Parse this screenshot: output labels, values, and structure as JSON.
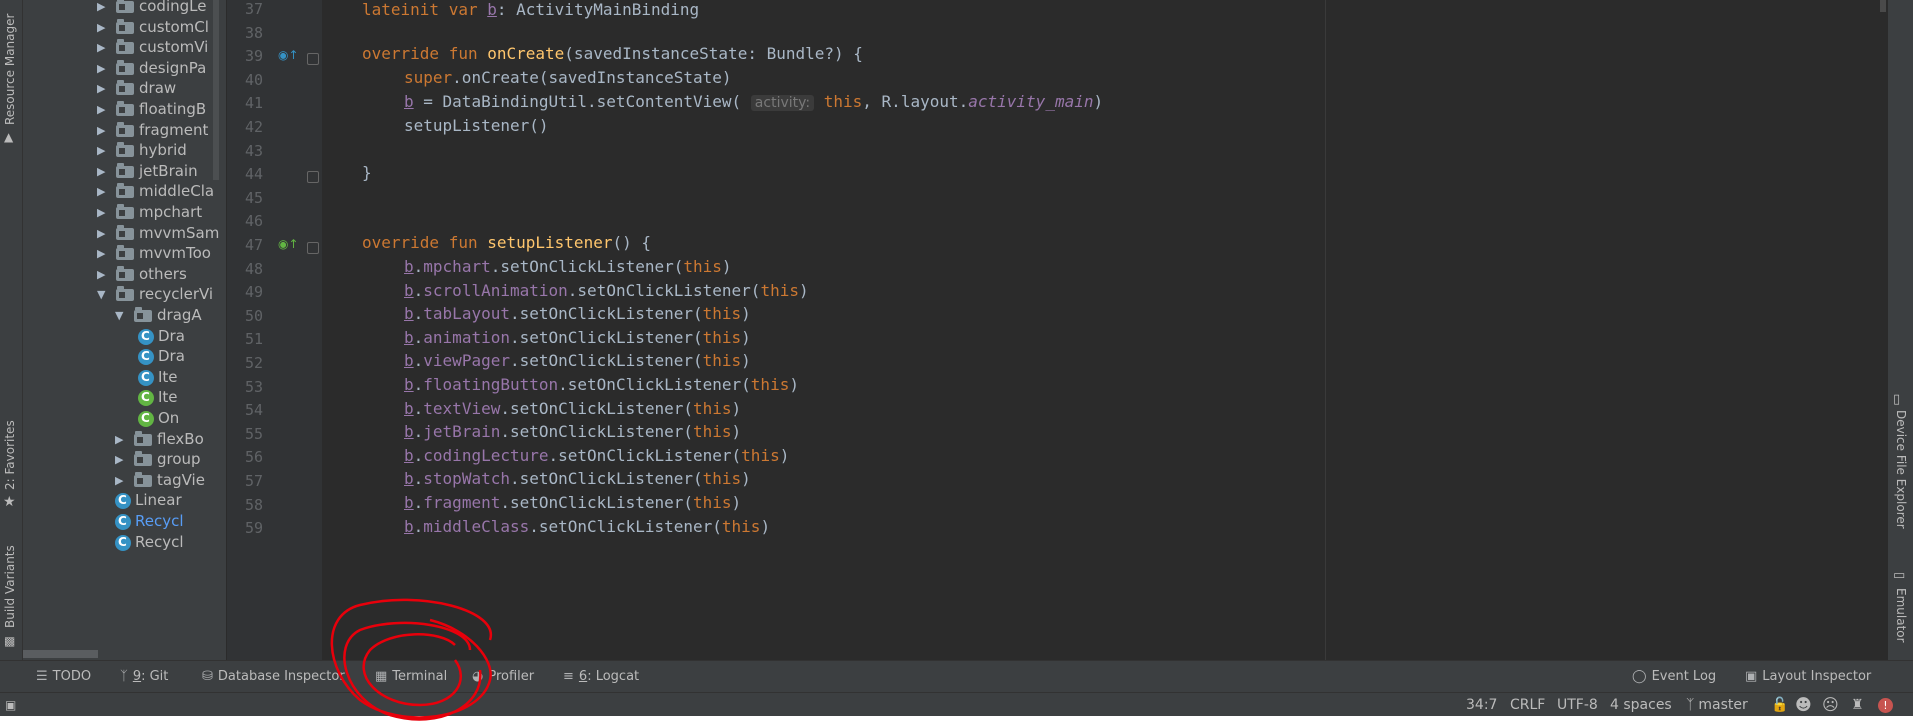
{
  "left_tabs": {
    "resource_manager": "Resource Manager",
    "favorites": "2: Favorites",
    "build_variants": "Build Variants"
  },
  "right_tabs": {
    "device_file_explorer": "Device File Explorer",
    "emulator": "Emulator"
  },
  "project_tree": [
    {
      "label": "codingLe",
      "type": "folder",
      "expanded": false
    },
    {
      "label": "customCl",
      "type": "folder",
      "expanded": false
    },
    {
      "label": "customVi",
      "type": "folder",
      "expanded": false
    },
    {
      "label": "designPa",
      "type": "folder",
      "expanded": false
    },
    {
      "label": "draw",
      "type": "folder",
      "expanded": false
    },
    {
      "label": "floatingB",
      "type": "folder",
      "expanded": false
    },
    {
      "label": "fragment",
      "type": "folder",
      "expanded": false
    },
    {
      "label": "hybrid",
      "type": "folder",
      "expanded": false
    },
    {
      "label": "jetBrain",
      "type": "folder",
      "expanded": false
    },
    {
      "label": "middleCla",
      "type": "folder",
      "expanded": false
    },
    {
      "label": "mpchart",
      "type": "folder",
      "expanded": false
    },
    {
      "label": "mvvmSam",
      "type": "folder",
      "expanded": false
    },
    {
      "label": "mvvmToo",
      "type": "folder",
      "expanded": false
    },
    {
      "label": "others",
      "type": "folder",
      "expanded": false
    },
    {
      "label": "recyclerVi",
      "type": "folder",
      "expanded": true
    },
    {
      "label": "dragA",
      "type": "folder",
      "expanded": true
    },
    {
      "label": "Dra",
      "type": "class"
    },
    {
      "label": "Dra",
      "type": "class"
    },
    {
      "label": "Ite",
      "type": "class"
    },
    {
      "label": "Ite",
      "type": "class-green"
    },
    {
      "label": "On",
      "type": "class-green"
    },
    {
      "label": "flexBo",
      "type": "folder",
      "expanded": false
    },
    {
      "label": "group",
      "type": "folder",
      "expanded": false
    },
    {
      "label": "tagVie",
      "type": "folder",
      "expanded": false
    },
    {
      "label": "Linear",
      "type": "class"
    },
    {
      "label": "Recycl",
      "type": "class",
      "highlight": true
    },
    {
      "label": "Recycl",
      "type": "class"
    }
  ],
  "editor": {
    "line_numbers": [
      "37",
      "38",
      "39",
      "40",
      "41",
      "42",
      "43",
      "44",
      "45",
      "46",
      "47",
      "48",
      "49",
      "50",
      "51",
      "52",
      "53",
      "54",
      "55",
      "56",
      "57",
      "58",
      "59"
    ],
    "l37": {
      "kw": "lateinit var ",
      "name": "b",
      "rest": ": ActivityMainBinding"
    },
    "l39": {
      "kw": "override fun ",
      "fn": "onCreate",
      "rest": "(savedInstanceState: Bundle?) {"
    },
    "l40": {
      "kw": "super",
      "rest": ".onCreate(savedInstanceState)"
    },
    "l41": {
      "name": "b",
      "mid": " = DataBindingUtil.setContentView( ",
      "hint": "activity:",
      "kw": " this",
      "rest": ", R.layout.",
      "it": "activity_main",
      "end": ")"
    },
    "l42": {
      "rest": "setupListener()"
    },
    "l44": {
      "rest": "}"
    },
    "l47": {
      "kw": "override fun ",
      "fn": "setupListener",
      "rest": "() {"
    },
    "listener_lines": [
      {
        "obj": "b",
        "prop": "mpchart",
        "call": ".setOnClickListener(",
        "arg": "this",
        "end": ")"
      },
      {
        "obj": "b",
        "prop": "scrollAnimation",
        "call": ".setOnClickListener(",
        "arg": "this",
        "end": ")"
      },
      {
        "obj": "b",
        "prop": "tabLayout",
        "call": ".setOnClickListener(",
        "arg": "this",
        "end": ")"
      },
      {
        "obj": "b",
        "prop": "animation",
        "call": ".setOnClickListener(",
        "arg": "this",
        "end": ")"
      },
      {
        "obj": "b",
        "prop": "viewPager",
        "call": ".setOnClickListener(",
        "arg": "this",
        "end": ")"
      },
      {
        "obj": "b",
        "prop": "floatingButton",
        "call": ".setOnClickListener(",
        "arg": "this",
        "end": ")"
      },
      {
        "obj": "b",
        "prop": "textView",
        "call": ".setOnClickListener(",
        "arg": "this",
        "end": ")"
      },
      {
        "obj": "b",
        "prop": "jetBrain",
        "call": ".setOnClickListener(",
        "arg": "this",
        "end": ")"
      },
      {
        "obj": "b",
        "prop": "codingLecture",
        "call": ".setOnClickListener(",
        "arg": "this",
        "end": ")"
      },
      {
        "obj": "b",
        "prop": "stopWatch",
        "call": ".setOnClickListener(",
        "arg": "this",
        "end": ")"
      },
      {
        "obj": "b",
        "prop": "fragment",
        "call": ".setOnClickListener(",
        "arg": "this",
        "end": ")"
      },
      {
        "obj": "b",
        "prop": "middleClass",
        "call": ".setOnClickListener(",
        "arg": "this",
        "end": ")"
      }
    ]
  },
  "tool_windows": {
    "todo": "TODO",
    "git_num": "9",
    "git_rest": ": Git",
    "database": "Database Inspector",
    "terminal": "Terminal",
    "profiler": "Profiler",
    "logcat_num": "6",
    "logcat_rest": ": Logcat",
    "event_log": "Event Log",
    "layout_inspector": "Layout Inspector"
  },
  "status": {
    "position": "34:7",
    "line_sep": "CRLF",
    "encoding": "UTF-8",
    "indent": "4 spaces",
    "branch": "master"
  },
  "colors": {
    "keyword": "#cc7832",
    "function": "#ffc66d",
    "property": "#9876aa",
    "annotation_circle": "#e8000b"
  }
}
